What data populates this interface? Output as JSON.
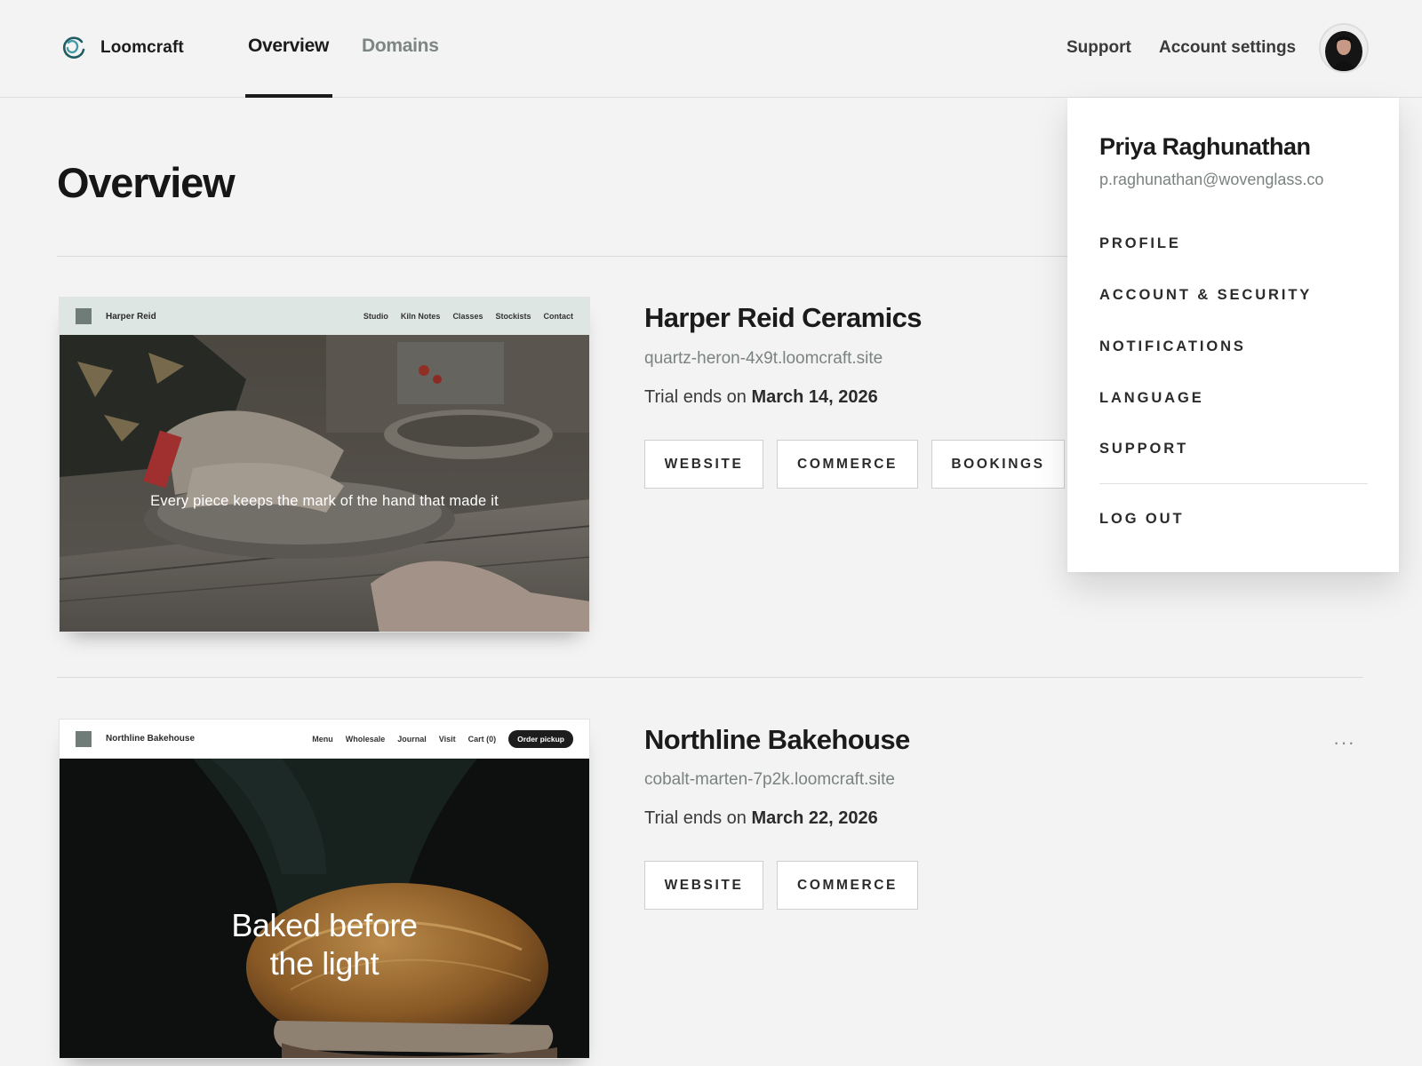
{
  "app": {
    "brand_name": "Loomcraft"
  },
  "nav": {
    "tabs": [
      {
        "label": "Overview",
        "active": true
      },
      {
        "label": "Domains",
        "active": false
      }
    ],
    "support_label": "Support",
    "account_settings_label": "Account settings"
  },
  "page": {
    "title": "Overview"
  },
  "sites": [
    {
      "name": "Harper Reid Ceramics",
      "url": "quartz-heron-4x9t.loomcraft.site",
      "trial_prefix": "Trial ends on",
      "trial_date": "March 14, 2026",
      "buttons": [
        "WEBSITE",
        "COMMERCE",
        "BOOKINGS"
      ],
      "preview": {
        "site_name": "Harper Reid",
        "nav": [
          "Studio",
          "Kiln Notes",
          "Classes",
          "Stockists",
          "Contact"
        ],
        "caption": "Every piece keeps the mark of the hand that made it"
      }
    },
    {
      "name": "Northline Bakehouse",
      "url": "cobalt-marten-7p2k.loomcraft.site",
      "trial_prefix": "Trial ends on",
      "trial_date": "March 22, 2026",
      "buttons": [
        "WEBSITE",
        "COMMERCE"
      ],
      "more_label": "···",
      "preview": {
        "site_name": "Northline Bakehouse",
        "nav": [
          "Menu",
          "Wholesale",
          "Journal",
          "Visit",
          "Cart (0)"
        ],
        "cta": "Order pickup",
        "caption_line1": "Baked before",
        "caption_line2": "the light"
      }
    }
  ],
  "account_menu": {
    "name": "Priya Raghunathan",
    "email": "p.raghunathan@wovenglass.co",
    "items": [
      "PROFILE",
      "ACCOUNT & SECURITY",
      "NOTIFICATIONS",
      "LANGUAGE",
      "SUPPORT"
    ],
    "logout": "LOG OUT"
  },
  "icons": {
    "brand": "loomcraft-logo-icon",
    "avatar": "user-avatar",
    "more": "more-horizontal-icon"
  },
  "colors": {
    "background": "#f3f3f3",
    "text": "#1b1b1b",
    "muted": "#7b8380",
    "preview_header_1": "#dde6e3",
    "preview_header_2": "#ffffff"
  }
}
